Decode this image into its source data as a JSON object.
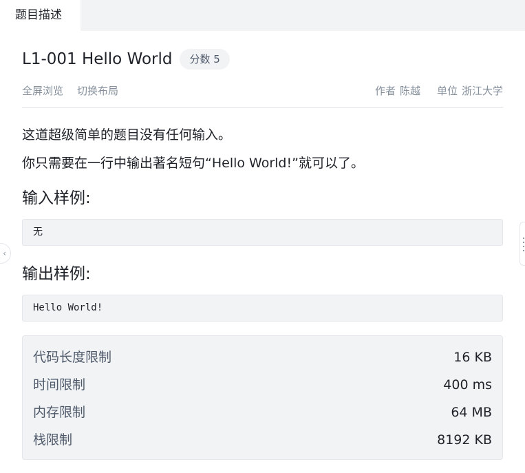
{
  "tab": {
    "label": "题目描述"
  },
  "problem": {
    "title": "L1-001 Hello World",
    "score": "分数 5",
    "actions": {
      "fullscreen": "全屏浏览",
      "switch_layout": "切换布局"
    },
    "author_label": "作者",
    "author": "陈越",
    "unit_label": "单位",
    "unit": "浙江大学",
    "description": [
      "这道超级简单的题目没有任何输入。",
      "你只需要在一行中输出著名短句“Hello World!”就可以了。"
    ],
    "sample_input_title": "输入样例:",
    "sample_input": "无",
    "sample_output_title": "输出样例:",
    "sample_output": "Hello World!"
  },
  "limits": [
    {
      "label": "代码长度限制",
      "value": "16 KB"
    },
    {
      "label": "时间限制",
      "value": "400 ms"
    },
    {
      "label": "内存限制",
      "value": "64 MB"
    },
    {
      "label": "栈限制",
      "value": "8192 KB"
    }
  ]
}
